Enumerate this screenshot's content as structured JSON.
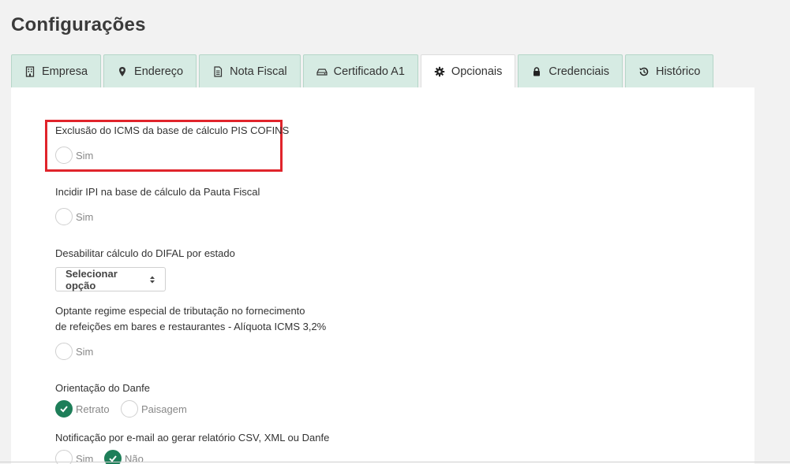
{
  "page": {
    "title": "Configurações"
  },
  "tabs": [
    {
      "label": "Empresa",
      "icon": "building-icon"
    },
    {
      "label": "Endereço",
      "icon": "map-marker-icon"
    },
    {
      "label": "Nota Fiscal",
      "icon": "document-icon"
    },
    {
      "label": "Certificado A1",
      "icon": "drive-icon"
    },
    {
      "label": "Opcionais",
      "icon": "gear-icon",
      "active": true
    },
    {
      "label": "Credenciais",
      "icon": "lock-icon"
    },
    {
      "label": "Histórico",
      "icon": "history-icon"
    }
  ],
  "options": {
    "icms_pis_cofins": {
      "label": "Exclusão do ICMS da base de cálculo PIS COFINS",
      "sim": "Sim"
    },
    "ipi_pauta": {
      "label": "Incidir IPI na base de cálculo da Pauta Fiscal",
      "sim": "Sim"
    },
    "difal": {
      "label": "Desabilitar cálculo do DIFAL por estado",
      "select_value": "Selecionar opção"
    },
    "regime_especial": {
      "label_line1": "Optante regime especial de tributação no fornecimento",
      "label_line2": "de refeições em bares e restaurantes - Alíquota ICMS 3,2%",
      "sim": "Sim"
    },
    "danfe_orientation": {
      "label": "Orientação do Danfe",
      "retrato": "Retrato",
      "paisagem": "Paisagem",
      "selected": "Retrato"
    },
    "email_notification": {
      "label": "Notificação por e-mail ao gerar relatório CSV, XML ou Danfe",
      "sim": "Sim",
      "nao": "Não",
      "selected": "Não"
    }
  },
  "colors": {
    "accent": "#1e7e59",
    "tab_bg": "#d6ebe3",
    "highlight": "#e0242b"
  }
}
